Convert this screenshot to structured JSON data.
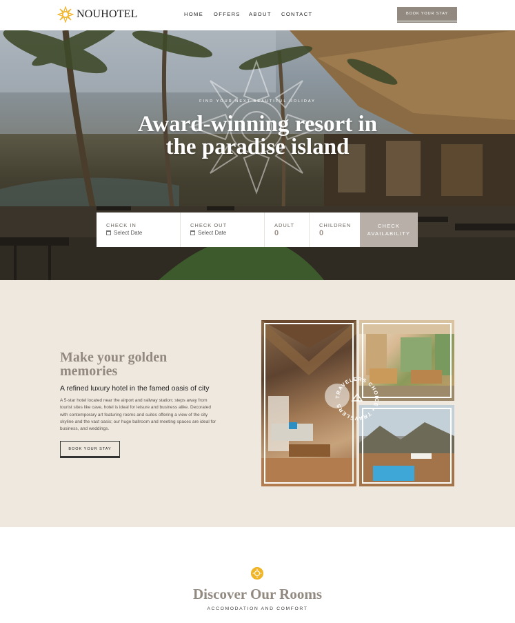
{
  "header": {
    "brand": "NOUHOTEL",
    "nav": [
      "HOME",
      "OFFERS",
      "ABOUT",
      "CONTACT"
    ],
    "book_label": "BOOK YOUR STAY"
  },
  "hero": {
    "eyebrow": "FIND YOUR NEXT BEAUTIFUL HOLIDAY",
    "title_line1": "Award-winning resort in",
    "title_line2": "the paradise island"
  },
  "booking": {
    "check_in_label": "CHECK IN",
    "check_in_value": "Select Date",
    "check_out_label": "CHECK OUT",
    "check_out_value": "Select Date",
    "adult_label": "ADULT",
    "adult_value": "0",
    "children_label": "CHILDREN",
    "children_value": "0",
    "button_label": "CHECK AVAILABILITY"
  },
  "about": {
    "title": "Make your golden memories",
    "subtitle": "A refined luxury hotel in the famed oasis of city",
    "body": "A 5-star hotel located near the airport and railway station; steps away from tourist sites like cave, hotel is ideal for leisure and business alike. Decorated with contemporary art featuring rooms and suites offering a view of the city skyline and the vast oasis; our huge ballroom and meeting spaces are ideal for business, and weddings.",
    "button_label": "BOOK YOUR STAY",
    "badge_text": "TRAVELERS CHOICE • TRAVELERS CHOICE •"
  },
  "rooms": {
    "title": "Discover Our Rooms",
    "subtitle": "ACCOMODATION AND COMFORT"
  },
  "colors": {
    "accent": "#928a80",
    "sand": "#efe8df",
    "gold": "#f0b429"
  }
}
